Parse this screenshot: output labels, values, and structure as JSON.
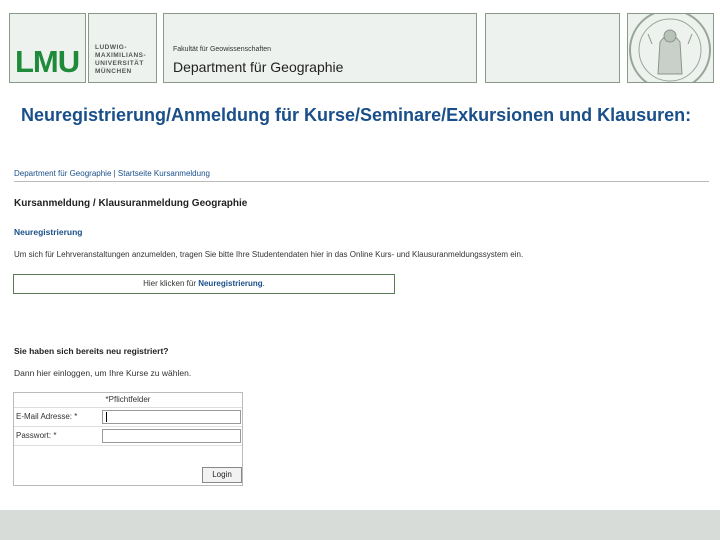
{
  "header": {
    "logo_text": "LMU",
    "university_name": "LUDWIG-\nMAXIMILIANS-\nUNIVERSITÄT\nMÜNCHEN",
    "faculty": "Fakultät für Geowissenschaften",
    "department": "Department für Geographie"
  },
  "slide": {
    "heading": "Neuregistrierung/Anmeldung für Kurse/Seminare/Exkursionen und Klausuren:"
  },
  "screenshot": {
    "breadcrumb": "Department für Geographie | Startseite Kursanmeldung",
    "title": "Kursanmeldung / Klausuranmeldung Geographie",
    "section_title": "Neuregistrierung",
    "description": "Um sich für Lehrveranstaltungen anzumelden, tragen Sie bitte Ihre Studentendaten hier in das Online Kurs- und Klausuranmeldungssystem ein.",
    "register_button": {
      "prefix": "Hier klicken für ",
      "strong": "Neuregistrierung",
      "suffix": "."
    },
    "question": "Sie haben sich bereits neu registriert?",
    "login_text": "Dann hier einloggen, um Ihre Kurse zu wählen.",
    "form": {
      "required_note": "*Pflichtfelder",
      "email_label": "E-Mail Adresse: *",
      "email_value": "",
      "password_label": "Passwort: *",
      "password_value": "",
      "login_button": "Login"
    }
  }
}
